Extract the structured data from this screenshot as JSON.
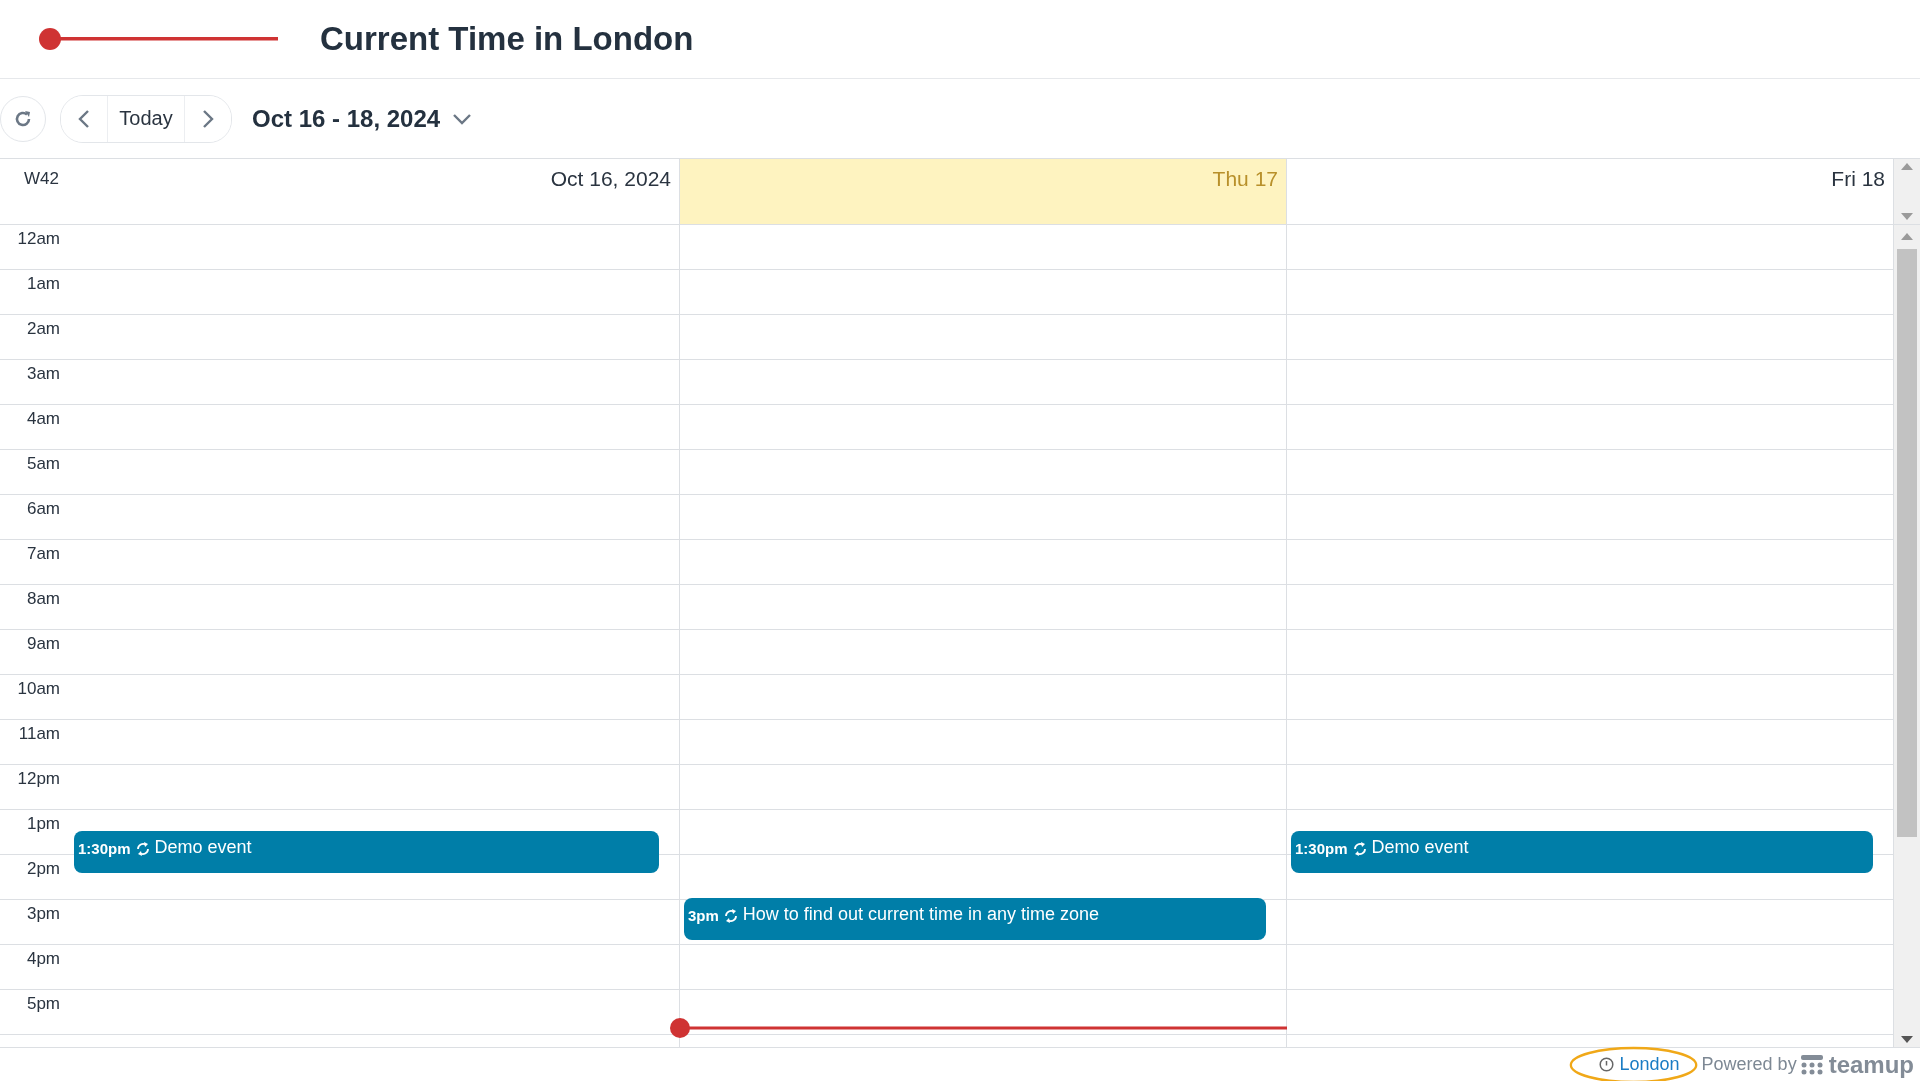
{
  "header": {
    "title": "Current Time in London"
  },
  "toolbar": {
    "today": "Today",
    "range": "Oct 16 - 18, 2024"
  },
  "calendar": {
    "week": "W42",
    "days": [
      {
        "label": "Oct 16, 2024",
        "today": false,
        "now": false,
        "events": [
          {
            "time": "1:30pm",
            "title": "Demo event",
            "recurring": true
          }
        ]
      },
      {
        "label": "Thu 17",
        "today": true,
        "now": true,
        "events": [
          {
            "time": "3pm",
            "title": "How to find out current time in any time zone",
            "recurring": true
          }
        ]
      },
      {
        "label": "Fri 18",
        "today": false,
        "now": false,
        "events": [
          {
            "time": "1:30pm",
            "title": "Demo event",
            "recurring": true
          }
        ]
      }
    ],
    "hours": [
      "12am",
      "1am",
      "2am",
      "3am",
      "4am",
      "5am",
      "6am",
      "7am",
      "8am",
      "9am",
      "10am",
      "11am",
      "12pm",
      "1pm",
      "2pm",
      "3pm",
      "4pm",
      "5pm"
    ]
  },
  "footer": {
    "timezone": "London",
    "powered": "Powered by",
    "brand": "teamup"
  }
}
